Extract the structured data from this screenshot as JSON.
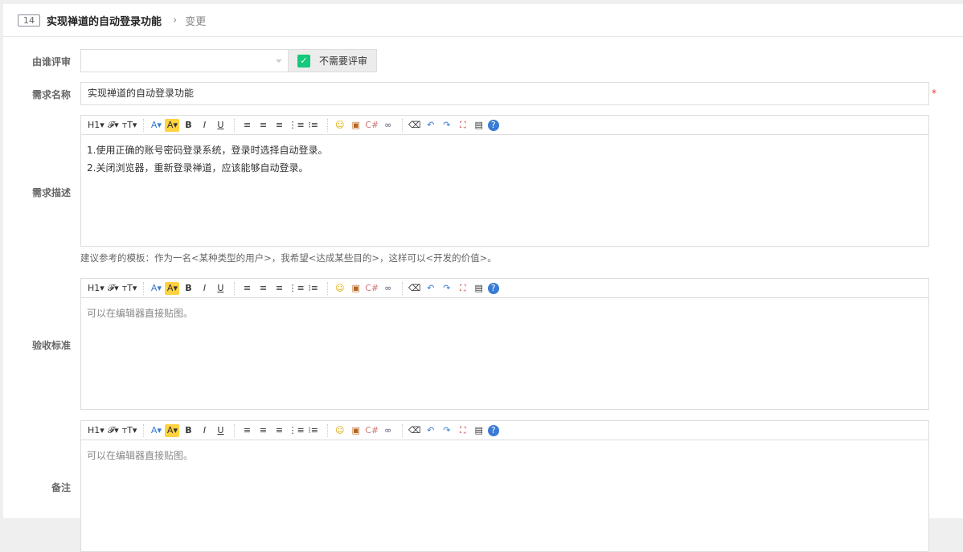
{
  "header": {
    "id": "14",
    "title": "实现禅道的自动登录功能",
    "crumb": "变更"
  },
  "form": {
    "reviewer_label": "由谁评审",
    "no_review": "不需要评审",
    "name_label": "需求名称",
    "name_value": "实现禅道的自动登录功能",
    "required": "*",
    "desc_label": "需求描述",
    "desc_lines": [
      "1.使用正确的账号密码登录系统，登录时选择自动登录。",
      "2.关闭浏览器，重新登录禅道，应该能够自动登录。"
    ],
    "hint": "建议参考的模板：作为一名<某种类型的用户>，我希望<达成某些目的>，这样可以<开发的价值>。",
    "verify_label": "验收标准",
    "verify_placeholder": "可以在编辑器直接贴图。",
    "comment_label": "备注",
    "comment_placeholder": "可以在编辑器直接贴图。"
  },
  "toolbar": [
    {
      "n": "heading",
      "g": "H1▾"
    },
    {
      "n": "font-family",
      "g": "𝓕▾"
    },
    {
      "n": "font-size",
      "g": "тT▾"
    },
    {
      "n": "sep"
    },
    {
      "n": "font-color",
      "g": "A▾",
      "c": "#3a7bd5"
    },
    {
      "n": "highlight",
      "g": "A▾",
      "bg": "#ffd23f"
    },
    {
      "n": "bold",
      "g": "B"
    },
    {
      "n": "italic",
      "g": "I"
    },
    {
      "n": "underline",
      "g": "U"
    },
    {
      "n": "sep"
    },
    {
      "n": "align-left",
      "g": "≡"
    },
    {
      "n": "align-center",
      "g": "≡"
    },
    {
      "n": "align-right",
      "g": "≡"
    },
    {
      "n": "ordered-list",
      "g": "⋮≡"
    },
    {
      "n": "unordered-list",
      "g": "⁝≡"
    },
    {
      "n": "sep"
    },
    {
      "n": "emoji",
      "g": "☺",
      "c": "#e0a800"
    },
    {
      "n": "image",
      "g": "▣",
      "c": "#b5651d"
    },
    {
      "n": "code",
      "g": "C#",
      "c": "#c77"
    },
    {
      "n": "link",
      "g": "∞",
      "c": "#557"
    },
    {
      "n": "sep"
    },
    {
      "n": "eraser",
      "g": "⌫"
    },
    {
      "n": "undo",
      "g": "↶",
      "c": "#3a7bd5"
    },
    {
      "n": "redo",
      "g": "↷",
      "c": "#3a7bd5"
    },
    {
      "n": "fullscreen",
      "g": "⛶",
      "c": "#c33"
    },
    {
      "n": "paste",
      "g": "▤"
    },
    {
      "n": "help",
      "g": "?",
      "c": "#fff",
      "bg": "#3a7bd5"
    }
  ]
}
